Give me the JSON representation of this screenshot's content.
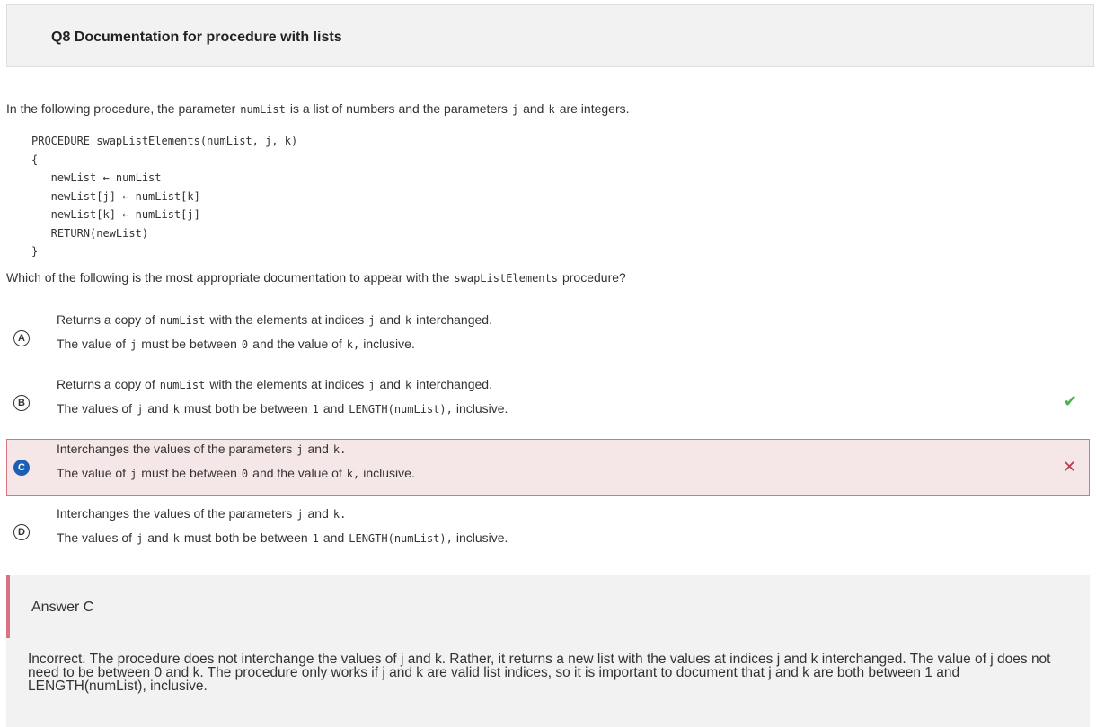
{
  "header": {
    "title": "Q8 Documentation for procedure with lists"
  },
  "stem": {
    "t1": "In the following procedure, the parameter",
    "c1": "numList",
    "t2": "is a list of numbers and the parameters",
    "c2": "j",
    "t3": "and",
    "c3": "k",
    "t4": "are integers."
  },
  "code": [
    "PROCEDURE swapListElements(numList, j, k)",
    "{",
    "   newList ← numList",
    "   newList[j] ← numList[k]",
    "   newList[k] ← numList[j]",
    "   RETURN(newList)",
    "}"
  ],
  "question": {
    "t1": "Which of the following is the most appropriate documentation to appear with the",
    "c1": "swapListElements",
    "t2": "procedure?"
  },
  "choices": {
    "a": {
      "letter": "A",
      "l1": {
        "t1": "Returns a copy of",
        "c1": "numList",
        "t2": "with the elements at indices",
        "c2": "j",
        "t3": "and",
        "c3": "k",
        "t4": "interchanged."
      },
      "l2": {
        "t1": "The value of",
        "c1": "j",
        "t2": "must be between",
        "c2": "0",
        "t3": "and the value of",
        "c3": "k,",
        "t4": "inclusive."
      }
    },
    "b": {
      "letter": "B",
      "l1": {
        "t1": "Returns a copy of",
        "c1": "numList",
        "t2": "with the elements at indices",
        "c2": "j",
        "t3": "and",
        "c3": "k",
        "t4": "interchanged."
      },
      "l2": {
        "t1": "The values of",
        "c1": "j",
        "t2": "and",
        "c2": "k",
        "t3": "must both be between",
        "c3": "1",
        "t4": "and",
        "c4": "LENGTH(numList),",
        "t5": "inclusive."
      },
      "mark": "✔"
    },
    "c": {
      "letter": "C",
      "l1": {
        "t1": "Interchanges the values of the parameters",
        "c1": "j",
        "t2": "and",
        "c2": "k."
      },
      "l2": {
        "t1": "The value of",
        "c1": "j",
        "t2": "must be between",
        "c2": "0",
        "t3": "and the value of",
        "c3": "k,",
        "t4": "inclusive."
      },
      "mark": "✕"
    },
    "d": {
      "letter": "D",
      "l1": {
        "t1": "Interchanges the values of the parameters",
        "c1": "j",
        "t2": "and",
        "c2": "k."
      },
      "l2": {
        "t1": "The values of",
        "c1": "j",
        "t2": "and",
        "c2": "k",
        "t3": "must both be between",
        "c3": "1",
        "t4": "and",
        "c4": "LENGTH(numList),",
        "t5": "inclusive."
      }
    }
  },
  "answer": {
    "label": "Answer C",
    "explanation": "Incorrect. The procedure does not interchange the values of j and k. Rather, it returns a new list with the values at indices j and k interchanged. The value of j does not need to be between 0 and k. The procedure only works if j and k are valid list indices, so it is important to document that j and k are both between 1 and LENGTH(numList), inclusive."
  },
  "colors": {
    "selected_bg": "#f5e6e7",
    "selected_border": "#d9737f",
    "correct": "#4caf50",
    "wrong": "#c0394b",
    "selected_radio": "#1a5fb4"
  },
  "icons": {
    "correct": "check-icon",
    "wrong": "x-icon"
  }
}
